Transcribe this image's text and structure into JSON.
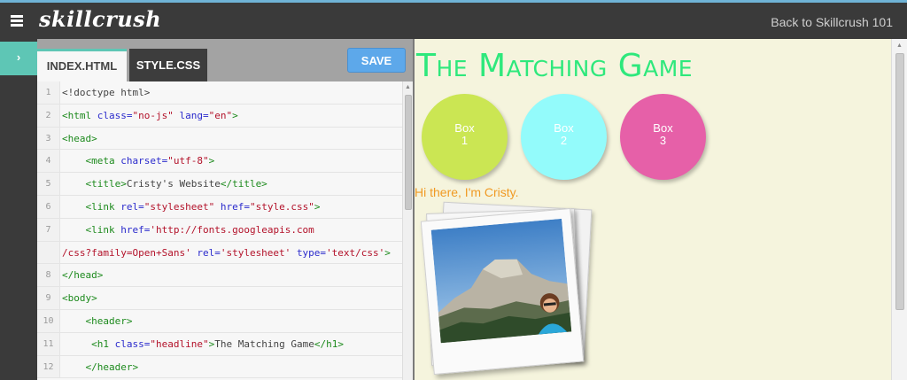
{
  "header": {
    "logo": "skillcrush",
    "back_link": "Back to Skillcrush 101"
  },
  "sidebar": {
    "toggle_glyph": "›"
  },
  "editor": {
    "tabs": [
      {
        "label": "INDEX.HTML"
      },
      {
        "label": "STYLE.CSS"
      }
    ],
    "save_label": "SAVE",
    "line_numbers": [
      "1",
      "2",
      "3",
      "4",
      "5",
      "6",
      "7",
      "",
      "8",
      "9",
      "10",
      "11",
      "12"
    ]
  },
  "preview": {
    "title": "The Matching Game",
    "boxes": [
      {
        "label_1": "Box",
        "label_2": "1",
        "color": "#cbe653"
      },
      {
        "label_1": "Box",
        "label_2": "2",
        "color": "#93fbfb"
      },
      {
        "label_1": "Box",
        "label_2": "3",
        "color": "#e660a8"
      }
    ],
    "greeting": "Hi there, I'm Cristy."
  },
  "colors": {
    "accent": "#5ec6b5",
    "save_button": "#5da8ea",
    "title": "#2ee87c",
    "greeting": "#f09a24"
  }
}
